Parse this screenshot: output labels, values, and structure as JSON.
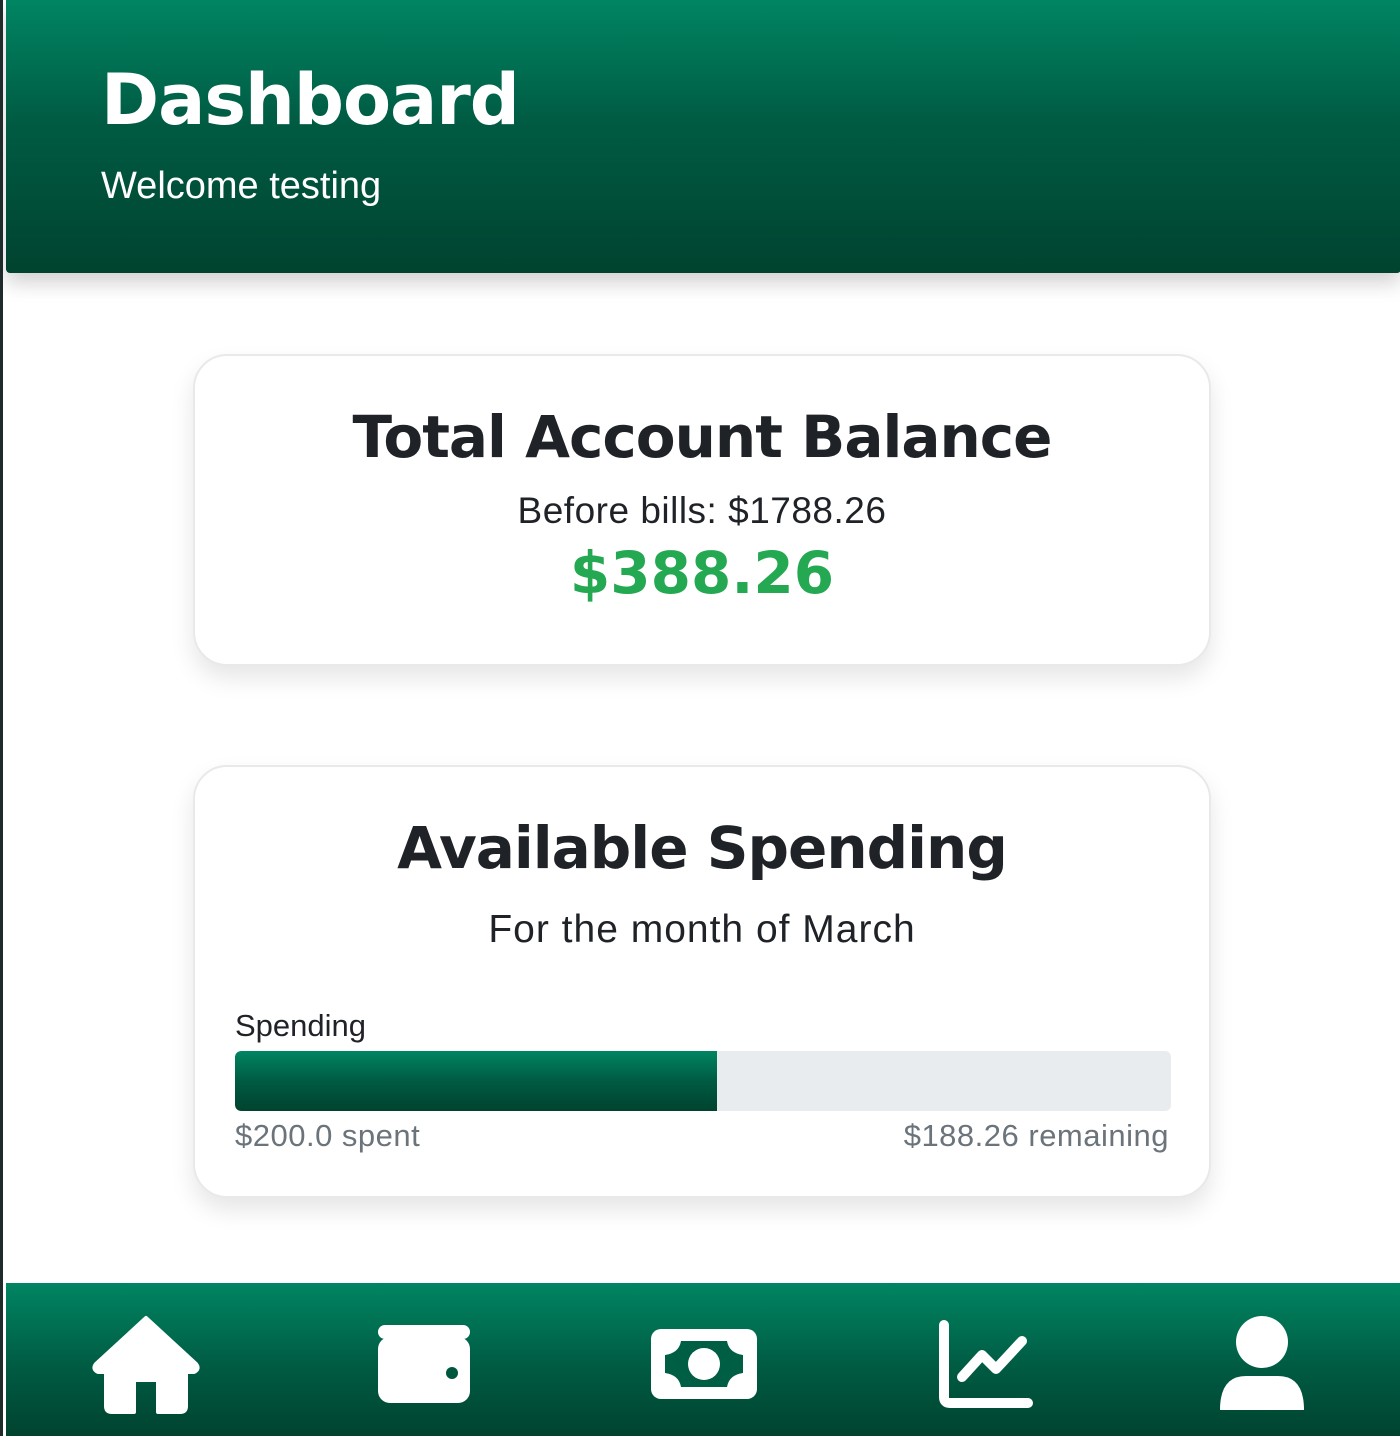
{
  "header": {
    "title": "Dashboard",
    "welcome": "Welcome testing"
  },
  "balance_card": {
    "title": "Total Account Balance",
    "before_bills": "Before bills: $1788.26",
    "amount": "$388.26",
    "amount_color": "#24a852"
  },
  "spending_card": {
    "title": "Available Spending",
    "subtitle": "For the month of March",
    "progress_label": "Spending",
    "progress_fraction": 0.515,
    "spent": "$200.0 spent",
    "remaining": "$188.26 remaining"
  },
  "nav": {
    "items": [
      {
        "icon": "home-icon"
      },
      {
        "icon": "wallet-icon"
      },
      {
        "icon": "money-bill-icon"
      },
      {
        "icon": "chart-line-icon"
      },
      {
        "icon": "user-icon"
      }
    ]
  },
  "colors": {
    "brand_green": "#008562",
    "brand_green_dark": "#00432f",
    "track_gray": "#e8ecef"
  }
}
